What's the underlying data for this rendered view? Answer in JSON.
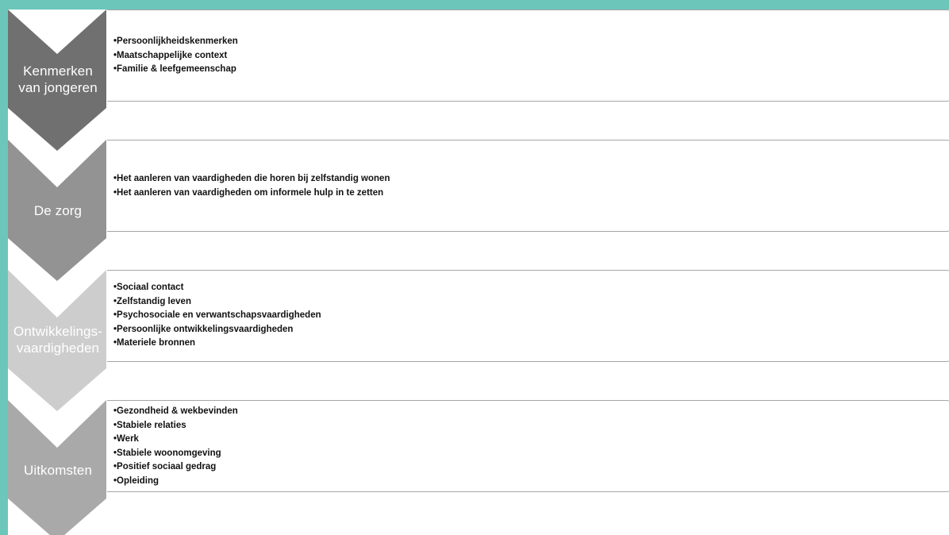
{
  "stages": [
    {
      "label_lines": [
        "Kenmerken",
        "van jongeren"
      ],
      "color": "#707070",
      "items": [
        "Persoonlijkheidskenmerken",
        "Maatschappelijke context",
        "Familie & leefgemeenschap"
      ]
    },
    {
      "label_lines": [
        "De zorg"
      ],
      "color": "#939393",
      "items": [
        "Het aanleren van vaardigheden die horen bij zelfstandig wonen",
        "Het aanleren van vaardigheden om informele hulp in te zetten"
      ]
    },
    {
      "label_lines": [
        "Ontwikkelings-",
        "vaardigheden"
      ],
      "color": "#cdcdcd",
      "items": [
        "Sociaal contact",
        "Zelfstandig leven",
        "Psychosociale en verwantschapsvaardigheden",
        "Persoonlijke ontwikkelingsvaardigheden",
        "Materiele bronnen"
      ]
    },
    {
      "label_lines": [
        "Uitkomsten"
      ],
      "color": "#a9a9a9",
      "items": [
        "Gezondheid & wekbevinden",
        "Stabiele relaties",
        "Werk",
        "Stabiele woonomgeving",
        "Positief sociaal gedrag",
        "Opleiding"
      ]
    }
  ],
  "colors": {
    "frame": "#6cc6ba",
    "card_border": "#a6a6a6"
  }
}
